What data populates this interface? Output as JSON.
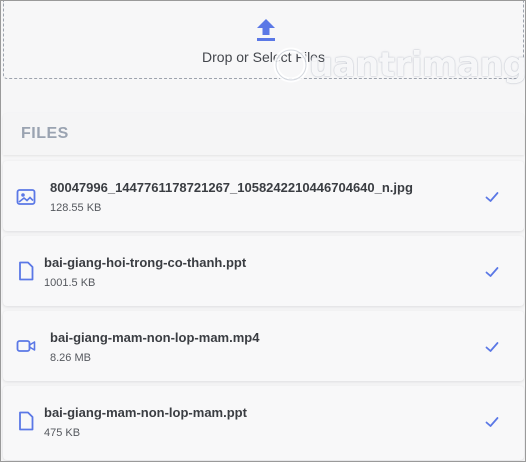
{
  "dropzone": {
    "label": "Drop or Select Files"
  },
  "watermark": {
    "text": "uantrimang"
  },
  "files_section": {
    "title": "FILES"
  },
  "files": [
    {
      "name": "80047996_1447761178721267_1058242210446704640_n.jpg",
      "size": "128.55 KB",
      "icon": "image-icon"
    },
    {
      "name": "bai-giang-hoi-trong-co-thanh.ppt",
      "size": "1001.5 KB",
      "icon": "file-icon"
    },
    {
      "name": "bai-giang-mam-non-lop-mam.mp4",
      "size": "8.26 MB",
      "icon": "video-icon"
    },
    {
      "name": "bai-giang-mam-non-lop-mam.ppt",
      "size": "475 KB",
      "icon": "file-icon"
    }
  ],
  "colors": {
    "accent": "#5b78e6",
    "title": "#9aa3b1"
  }
}
